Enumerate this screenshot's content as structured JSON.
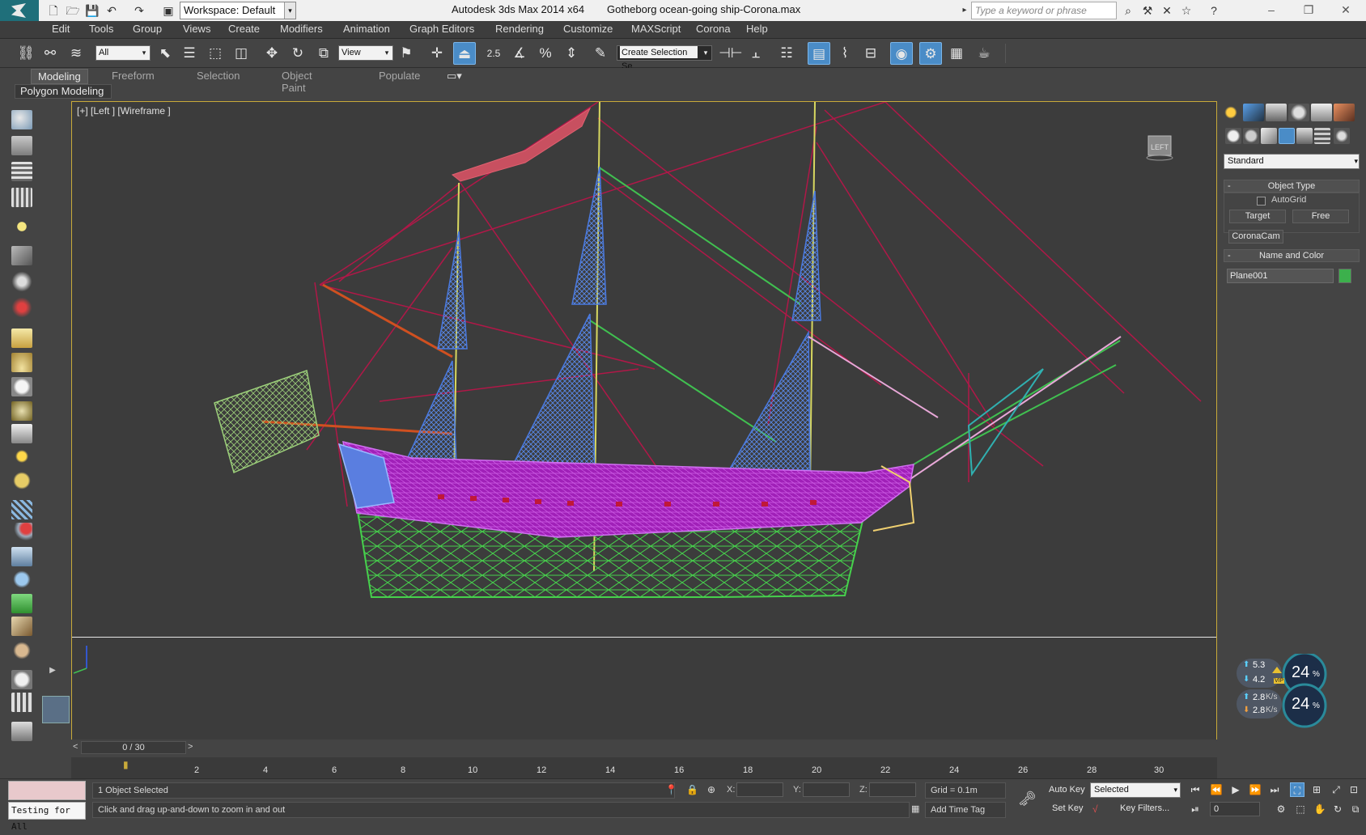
{
  "titlebar": {
    "workspace": "Workspace: Default",
    "app_title": "Autodesk 3ds Max  2014 x64",
    "file_title": "Gotheborg ocean-going ship-Corona.max",
    "search_placeholder": "Type a keyword or phrase"
  },
  "menubar": {
    "items": [
      "Edit",
      "Tools",
      "Group",
      "Views",
      "Create",
      "Modifiers",
      "Animation",
      "Graph Editors",
      "Rendering",
      "Customize",
      "MAXScript",
      "Corona",
      "Help"
    ]
  },
  "toolbar": {
    "selection_filter": "All",
    "ref_coord": "View",
    "snap_value": "2.5",
    "named_selection": "Create Selection Se"
  },
  "ribbon": {
    "tabs": [
      "Modeling",
      "Freeform",
      "Selection",
      "Object Paint",
      "Populate"
    ],
    "panel_label": "Polygon Modeling"
  },
  "viewport": {
    "label": "[+] [Left ] [Wireframe ]",
    "viewcube_face": "LEFT"
  },
  "command_panel": {
    "category": "Standard",
    "object_type_title": "Object Type",
    "autogrid_label": "AutoGrid",
    "buttons": [
      "Target",
      "Free",
      "CoronaCam"
    ],
    "name_color_title": "Name and Color",
    "object_name": "Plane001",
    "object_color": "#3cb04c"
  },
  "net_widget": {
    "upload_top": "5.3",
    "download_top": "4.2",
    "percent_top": "24",
    "upload_bottom": "2.8",
    "download_bottom": "2.8",
    "percent_bottom": "24",
    "unit": "K/s",
    "vip_label": "VIP"
  },
  "timeline": {
    "frame_display": "0 / 30",
    "ticks": [
      "2",
      "4",
      "6",
      "8",
      "10",
      "12",
      "14",
      "16",
      "18",
      "20",
      "22",
      "24",
      "26",
      "28",
      "30"
    ]
  },
  "status": {
    "maxscript_text": "Testing for All",
    "objects_selected": "1 Object Selected",
    "prompt": "Click and drag up-and-down to zoom in and out",
    "x_label": "X:",
    "y_label": "Y:",
    "z_label": "Z:",
    "grid": "Grid = 0.1m",
    "add_time_tag": "Add Time Tag",
    "auto_key": "Auto Key",
    "set_key": "Set Key",
    "key_filters": "Key Filters...",
    "key_mode": "Selected",
    "current_frame": "0"
  },
  "colors": {
    "viewport_border": "#c8aa3a",
    "hull": "#b020c8",
    "underwater": "#40d050",
    "sails": "#4a7ae0",
    "rigging": "#b01848",
    "active_button": "#4a8cc7"
  }
}
